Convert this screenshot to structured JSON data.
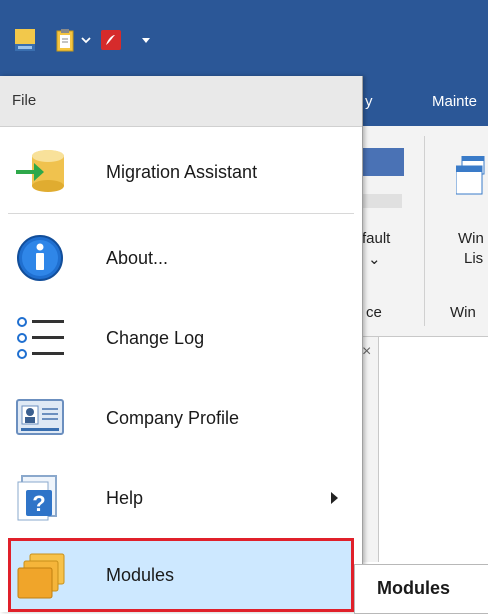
{
  "quick_access": {
    "icons": [
      "app-icon",
      "clipboard-icon",
      "chevron-down-icon",
      "pdf-icon",
      "dropdown-arrow-icon"
    ]
  },
  "ribbon": {
    "tab_partial_1": "y",
    "tab_partial_2": "Mainte",
    "btn_default_1": "fault",
    "btn_default_2": "⌄",
    "btn_window_1": "Win",
    "btn_window_2": "Lis",
    "group_1": "ce",
    "group_2": "Win",
    "panel_close": "×"
  },
  "menu": {
    "header": "File",
    "items": [
      {
        "label": "Migration Assistant",
        "icon": "migration-database-icon"
      },
      {
        "label": "About...",
        "icon": "info-icon"
      },
      {
        "label": "Change Log",
        "icon": "list-icon"
      },
      {
        "label": "Company Profile",
        "icon": "id-card-icon"
      },
      {
        "label": "Help",
        "icon": "help-book-icon"
      },
      {
        "label": "Modules",
        "icon": "modules-folders-icon"
      }
    ]
  },
  "submenu": {
    "label": "Modules"
  },
  "colors": {
    "title_blue": "#2b5797",
    "highlight_bg": "#cde8ff",
    "highlight_border": "#e0202a"
  }
}
